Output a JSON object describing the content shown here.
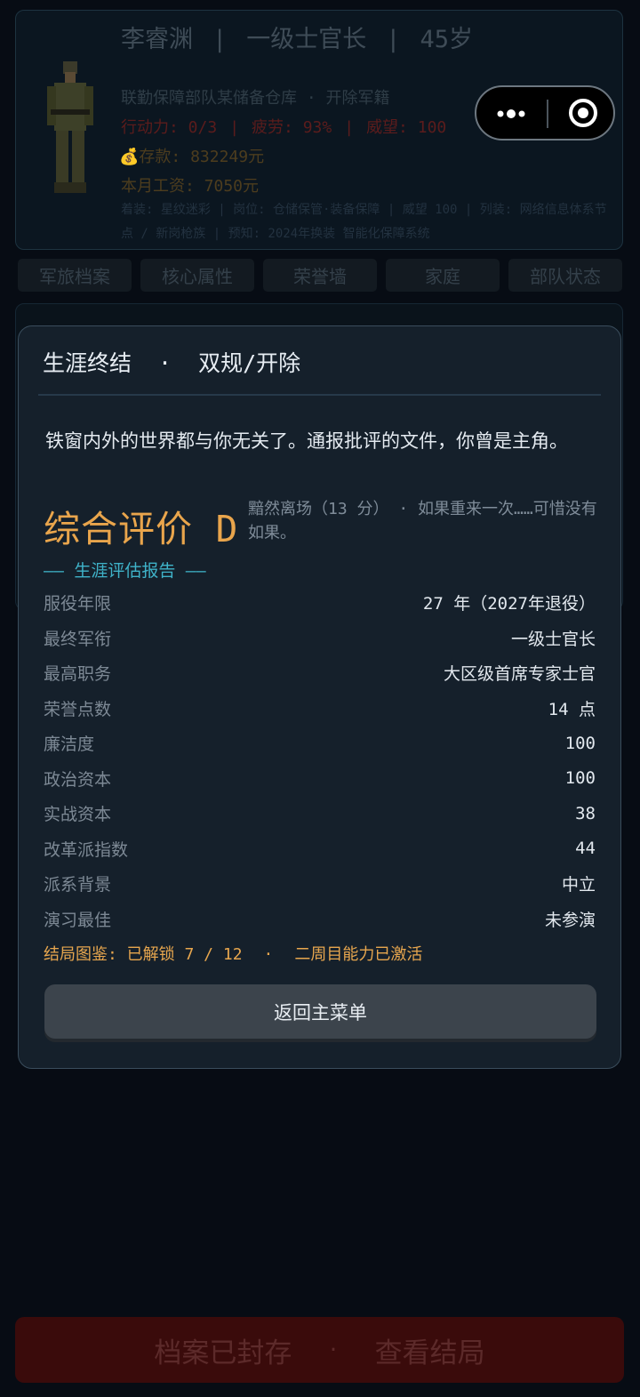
{
  "profile": {
    "name": "李睿渊",
    "rank": "一级士官长",
    "age": "45岁",
    "unit_line": "联勤保障部队某储备仓库 · 开除军籍",
    "action": "行动力: 0/3",
    "fatigue": "疲劳: 93%",
    "prestige": "威望: 100",
    "savings_icon": "money-bag-icon",
    "savings": "存款: 832249元",
    "salary": "本月工资: 7050元",
    "extra": "着装: 星纹迷彩 | 岗位: 仓储保管·装备保障 | 威望 100 | 列装: 网络信息体系节点 / 新岗枪族 | 预知: 2024年换装 智能化保障系统"
  },
  "tabs": [
    "军旅档案",
    "核心属性",
    "荣誉墙",
    "家庭",
    "部队状态"
  ],
  "modal": {
    "title": "生涯终结",
    "title_dot": "·",
    "subtitle": "双规/开除",
    "narrative": "铁窗内外的世界都与你无关了。通报批评的文件，你曾是主角。",
    "grade": "综合评价 D",
    "grade_comment": "黯然离场（13 分） · 如果重来一次……可惜没有如果。",
    "report_heading": "—— 生涯评估报告 ——",
    "rows": [
      {
        "label": "服役年限",
        "value": "27 年（2027年退役）"
      },
      {
        "label": "最终军衔",
        "value": "一级士官长"
      },
      {
        "label": "最高职务",
        "value": "大区级首席专家士官"
      },
      {
        "label": "荣誉点数",
        "value": "14 点"
      },
      {
        "label": "廉洁度",
        "value": "100"
      },
      {
        "label": "政治资本",
        "value": "100"
      },
      {
        "label": "实战资本",
        "value": "38"
      },
      {
        "label": "改革派指数",
        "value": "44"
      },
      {
        "label": "派系背景",
        "value": "中立"
      },
      {
        "label": "演习最佳",
        "value": "未参演"
      }
    ],
    "endings_unlocked": "结局图鉴: 已解锁 7 / 12",
    "endings_dot": "·",
    "second_run": "二周目能力已激活",
    "return_button": "返回主菜单"
  },
  "bottom_bar": {
    "left": "档案已封存",
    "dot": "·",
    "right": "查看结局"
  },
  "colors": {
    "background": "#070c14",
    "modal": "#15202b",
    "grade": "#e9a54c",
    "report_heading": "#3fb3c9",
    "bottom_bar": "#3a0b0b"
  }
}
